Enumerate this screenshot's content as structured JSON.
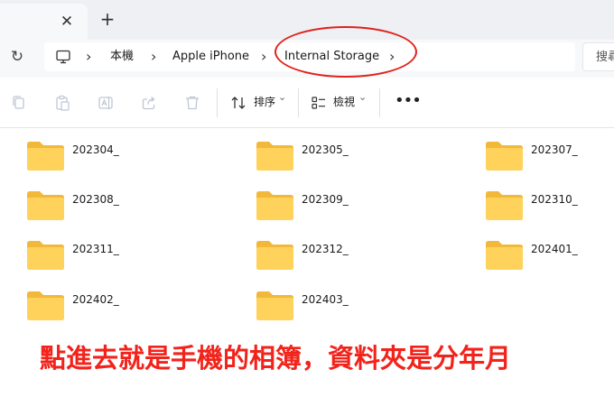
{
  "tabbar": {
    "close_glyph": "✕",
    "new_tab_glyph": "+"
  },
  "address": {
    "refresh_glyph": "↻",
    "chevron": "›",
    "crumbs": [
      "本機",
      "Apple iPhone",
      "Internal Storage"
    ],
    "search_placeholder": "搜尋"
  },
  "toolbar": {
    "sort_label": "排序",
    "view_label": "檢視",
    "dropdown_glyph": "⌄",
    "more_glyph": "•••"
  },
  "folders": [
    {
      "name": "202304_"
    },
    {
      "name": "202305_"
    },
    {
      "name": "202307_"
    },
    {
      "name": "202308_"
    },
    {
      "name": "202309_"
    },
    {
      "name": "202310_"
    },
    {
      "name": "202311_"
    },
    {
      "name": "202312_"
    },
    {
      "name": "202401_"
    },
    {
      "name": "202402_"
    },
    {
      "name": "202403_"
    }
  ],
  "annotation": {
    "caption": "點進去就是手機的相簿，資料夾是分年月",
    "color": "#f2231b"
  },
  "colors": {
    "folder_front": "#ffd25c",
    "folder_back": "#f2b83a",
    "annotation_red": "#e0221c"
  }
}
